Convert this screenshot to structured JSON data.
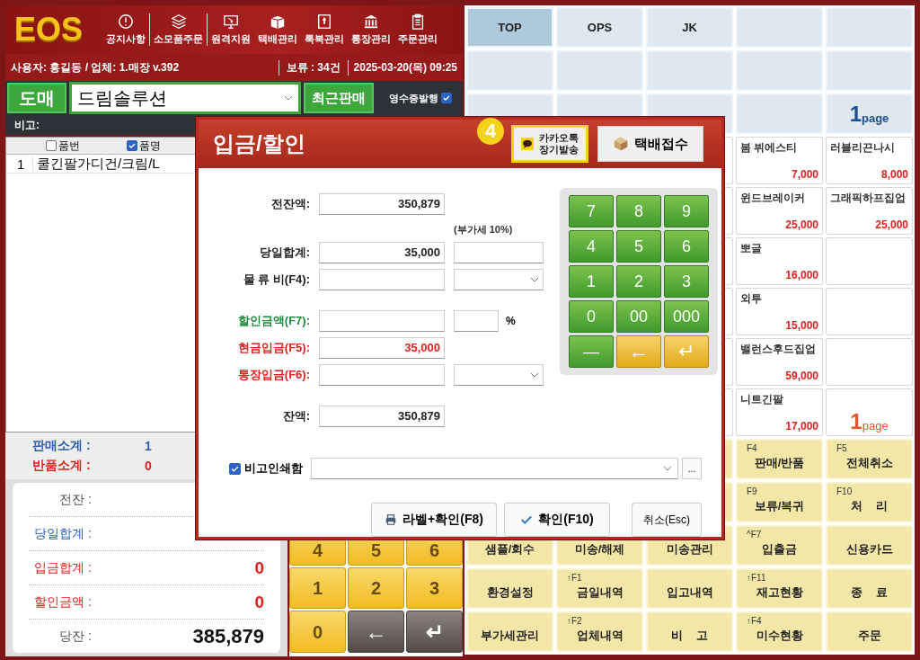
{
  "header": {
    "logo": "EOS",
    "nav": [
      {
        "label": "공지사항"
      },
      {
        "label": "소모품주문"
      },
      {
        "label": "원격지원"
      },
      {
        "label": "택배관리"
      },
      {
        "label": "룩북관리"
      },
      {
        "label": "통장관리"
      },
      {
        "label": "주문관리"
      }
    ]
  },
  "info": {
    "user": "사용자: 홍길동 / 업체: 1.매장 v.392",
    "hold": "보류 : 34건",
    "datetime": "2025-03-20(목) 09:25"
  },
  "toolbar": {
    "mode_button": "도매",
    "customer": "드림솔루션",
    "recent_button": "최근판매",
    "receipt": {
      "label": "영수증발행",
      "checked": true
    }
  },
  "memo_label": "비고:",
  "table": {
    "columns": [
      {
        "label": "품번",
        "checked": false
      },
      {
        "label": "품명",
        "checked": true
      }
    ],
    "rows": [
      {
        "no": "1",
        "name": "쿨긴팔가디건/크림/L"
      }
    ]
  },
  "subtotals": [
    {
      "label": "판매소계 :",
      "value": "1",
      "kind": "blue"
    },
    {
      "label": "반품소계 :",
      "value": "0",
      "kind": "red"
    }
  ],
  "summary": [
    {
      "label": "전잔 :",
      "kind": "normal"
    },
    {
      "label": "당일합계 :",
      "kind": "blue"
    },
    {
      "label": "입금합계 :",
      "value": "0",
      "kind": "red"
    },
    {
      "label": "할인금액 :",
      "value": "0",
      "kind": "red"
    },
    {
      "label": "당잔 :",
      "value": "385,879",
      "kind": "normal"
    }
  ],
  "small_keypad": [
    {
      "label": "4",
      "kind": "digit"
    },
    {
      "label": "5",
      "kind": "digit"
    },
    {
      "label": "6",
      "kind": "digit"
    },
    {
      "label": "1",
      "kind": "digit"
    },
    {
      "label": "2",
      "kind": "digit"
    },
    {
      "label": "3",
      "kind": "digit"
    },
    {
      "label": "0",
      "kind": "digit"
    },
    {
      "label": "←",
      "kind": "nav"
    },
    {
      "label": "↵",
      "kind": "nav"
    }
  ],
  "categories": [
    {
      "label": "TOP",
      "selected": true
    },
    {
      "label": "OPS",
      "selected": false
    },
    {
      "label": "JK",
      "selected": false
    }
  ],
  "category_page": {
    "number": "1",
    "unit": "page"
  },
  "products": [
    {
      "kind": "product",
      "name": "봄 뷔에스티",
      "price": "7,000"
    },
    {
      "kind": "product",
      "name": "러블리끈나시",
      "price": "8,000"
    },
    {
      "kind": "product",
      "name": "윈드브레이커",
      "price": "25,000"
    },
    {
      "kind": "product",
      "name": "그래픽하프집업",
      "price": "25,000"
    },
    {
      "kind": "product",
      "name": "뽀글",
      "price": "16,000"
    },
    {
      "kind": "empty"
    },
    {
      "kind": "product",
      "name": "외투",
      "price": "15,000"
    },
    {
      "kind": "empty"
    },
    {
      "kind": "product",
      "name": "밸런스후드집업",
      "price": "59,000"
    },
    {
      "kind": "empty"
    },
    {
      "kind": "product",
      "name": "니트긴팔",
      "price": "17,000"
    },
    {
      "kind": "page",
      "number": "1",
      "unit": "page"
    }
  ],
  "functions": [
    {
      "key": "F4",
      "label": "판매/반품"
    },
    {
      "key": "F5",
      "label": "전체취소"
    },
    {
      "key": "F9",
      "label": "보류/복귀"
    },
    {
      "key": "F10",
      "label": "처    리"
    },
    {
      "label": "샘플/회수"
    },
    {
      "label": "미송/해제"
    },
    {
      "label": "미송관리"
    },
    {
      "key": "^F7",
      "label": "입출금"
    },
    {
      "label": "신용카드"
    },
    {
      "label": "환경설정"
    },
    {
      "key": "↑F1",
      "label": "금일내역"
    },
    {
      "label": "입고내역"
    },
    {
      "key": "↑F11",
      "label": "재고현황"
    },
    {
      "label": "종    료"
    },
    {
      "label": "부가세관리"
    },
    {
      "key": "↑F2",
      "label": "업체내역"
    },
    {
      "label": "비    고"
    },
    {
      "key": "↑F4",
      "label": "미수현황"
    },
    {
      "label": "주문"
    }
  ],
  "dialog": {
    "title": "입금/할인",
    "step_badge": "4",
    "kakao_button": {
      "lines": [
        "카카오톡",
        "장기발송"
      ],
      "highlighted": true
    },
    "parcel_button": "택배접수",
    "vat_header": "(부가세 10%)",
    "fields": [
      {
        "label": "전잔액:",
        "value": "350,879",
        "kind": "plain",
        "color": "#222222"
      },
      {
        "label": "당일합계:",
        "value": "35,000",
        "kind": "vat",
        "color": "#222222"
      },
      {
        "label": "물 류 비(F4):",
        "kind": "select",
        "color": "#222222"
      },
      {
        "label": "할인금액(F7):",
        "kind": "percent",
        "unit": "%",
        "color": "#1f8a3c"
      },
      {
        "label": "현금입금(F5):",
        "value": "35,000",
        "kind": "plain",
        "color": "#e0201c"
      },
      {
        "label": "통장입금(F6):",
        "kind": "select",
        "color": "#e0201c"
      },
      {
        "label": "잔액:",
        "value": "350,879",
        "kind": "plain",
        "color": "#222222"
      }
    ],
    "keypad": [
      {
        "label": "7",
        "kind": "green"
      },
      {
        "label": "8",
        "kind": "green"
      },
      {
        "label": "9",
        "kind": "green"
      },
      {
        "label": "4",
        "kind": "green"
      },
      {
        "label": "5",
        "kind": "green"
      },
      {
        "label": "6",
        "kind": "green"
      },
      {
        "label": "1",
        "kind": "green"
      },
      {
        "label": "2",
        "kind": "green"
      },
      {
        "label": "3",
        "kind": "green"
      },
      {
        "label": "0",
        "kind": "green"
      },
      {
        "label": "00",
        "kind": "green"
      },
      {
        "label": "000",
        "kind": "green"
      },
      {
        "label": "—",
        "kind": "green"
      },
      {
        "label": "←",
        "kind": "yellow"
      },
      {
        "label": "↵",
        "kind": "yellow"
      }
    ],
    "memo": {
      "label": "비고인쇄함",
      "checked": true,
      "more": "..."
    },
    "buttons": [
      {
        "label": "라벨+확인(F8)",
        "kind": "print"
      },
      {
        "label": "확인(F10)",
        "kind": "confirm"
      },
      {
        "label": "취소(Esc)",
        "kind": "cancel"
      }
    ]
  }
}
